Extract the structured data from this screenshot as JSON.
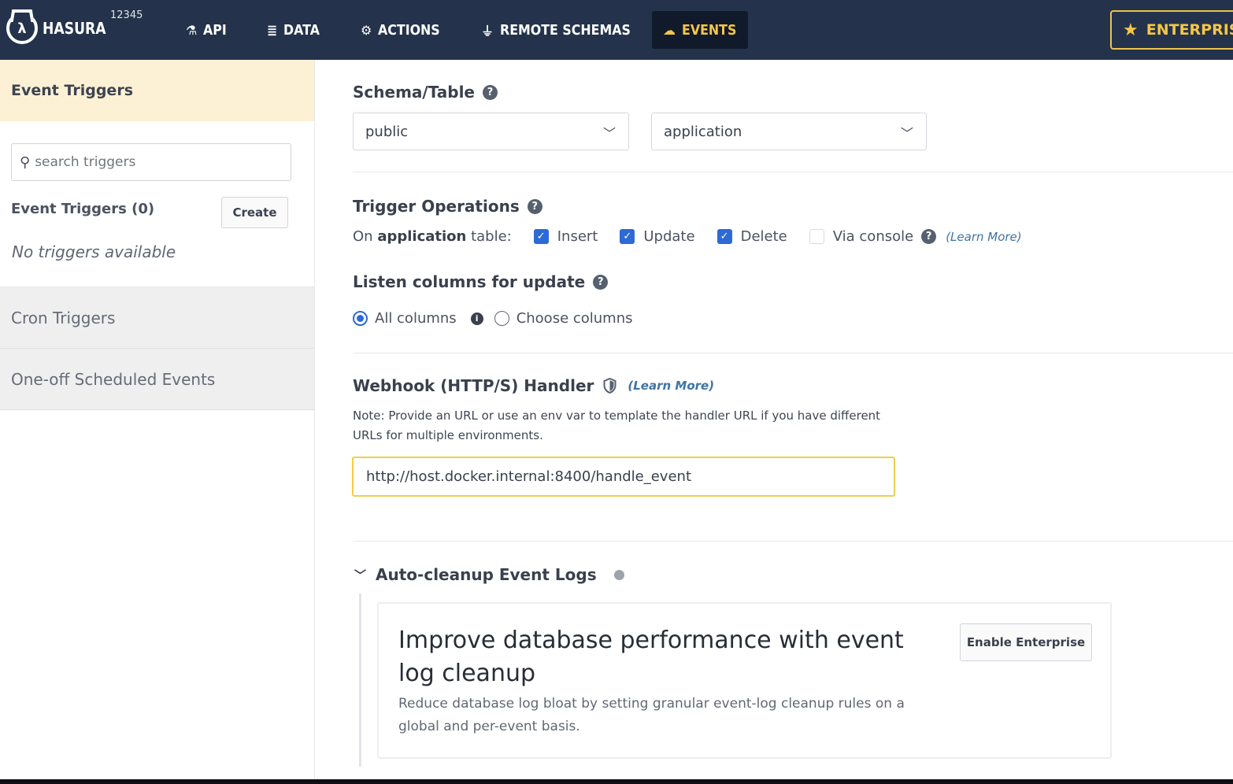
{
  "header": {
    "brand": "HASURA",
    "project_id": "12345",
    "nav": [
      {
        "label": "API",
        "icon": "flask-icon"
      },
      {
        "label": "DATA",
        "icon": "database-icon"
      },
      {
        "label": "ACTIONS",
        "icon": "actions-icon"
      },
      {
        "label": "REMOTE SCHEMAS",
        "icon": "plug-icon"
      },
      {
        "label": "EVENTS",
        "icon": "cloud-icon",
        "active": true
      }
    ],
    "enterprise_label": "ENTERPRISE",
    "colors": {
      "navbar": "#24334b",
      "accent": "#f8c646",
      "active_bg": "#111a2b"
    }
  },
  "sidebar": {
    "heading": "Event Triggers",
    "search_placeholder": "search triggers",
    "list_title": "Event Triggers (0)",
    "create_label": "Create",
    "empty_text": "No triggers available",
    "links": [
      "Cron Triggers",
      "One-off Scheduled Events"
    ]
  },
  "main": {
    "schema_table_title": "Schema/Table",
    "schema_value": "public",
    "table_value": "application",
    "trigger_ops_title": "Trigger Operations",
    "ops_prefix": "On",
    "ops_table": "application",
    "ops_suffix": "table:",
    "ops": [
      {
        "label": "Insert",
        "checked": true
      },
      {
        "label": "Update",
        "checked": true
      },
      {
        "label": "Delete",
        "checked": true
      },
      {
        "label": "Via console",
        "checked": false
      }
    ],
    "learn_more": "(Learn More)",
    "listen_title": "Listen columns for update",
    "radio_all": "All columns",
    "radio_choose": "Choose columns",
    "webhook_title": "Webhook (HTTP/S) Handler",
    "webhook_note": "Note: Provide an URL or use an env var to template the handler URL if you have different URLs for multiple environments.",
    "webhook_value": "http://host.docker.internal:8400/handle_event",
    "autocleanup_title": "Auto-cleanup Event Logs",
    "promo_title": "Improve database performance with event log cleanup",
    "promo_text": "Reduce database log bloat by setting granular event-log cleanup rules on a global and per-event basis.",
    "enable_label": "Enable Enterprise"
  }
}
